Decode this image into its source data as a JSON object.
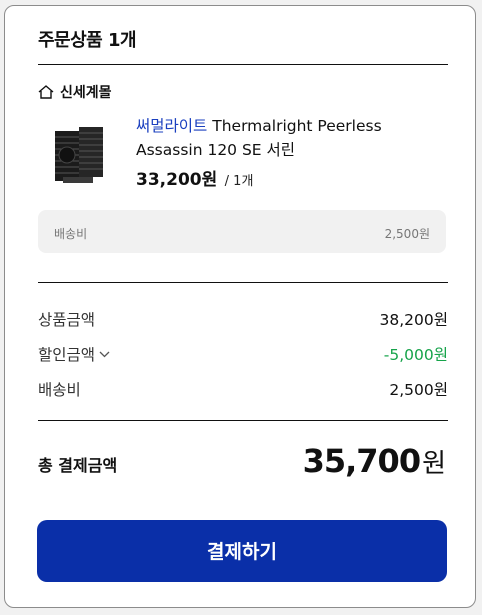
{
  "order": {
    "title": "주문상품 1개",
    "store_name": "신세계몰",
    "product": {
      "brand": "써멀라이트",
      "name": " Thermalright Peerless Assassin 120 SE 서린",
      "price": "33,200원",
      "qty": "/ 1개"
    },
    "shipping_box": {
      "label": "배송비",
      "value": "2,500원"
    }
  },
  "summary": {
    "items": [
      {
        "label": "상품금액",
        "value": "38,200원"
      },
      {
        "label": "할인금액",
        "value": "-5,000원"
      },
      {
        "label": "배송비",
        "value": "2,500원"
      }
    ],
    "total_label": "총 결제금액",
    "total_value": "35,700",
    "total_unit": "원"
  },
  "pay_button": "결제하기",
  "colors": {
    "accent": "#0a2fa8",
    "brand_link": "#1a3fbf",
    "discount": "#16a34a"
  },
  "icons": {
    "store": "home-outline-icon",
    "discount_toggle": "chevron-down-icon"
  }
}
